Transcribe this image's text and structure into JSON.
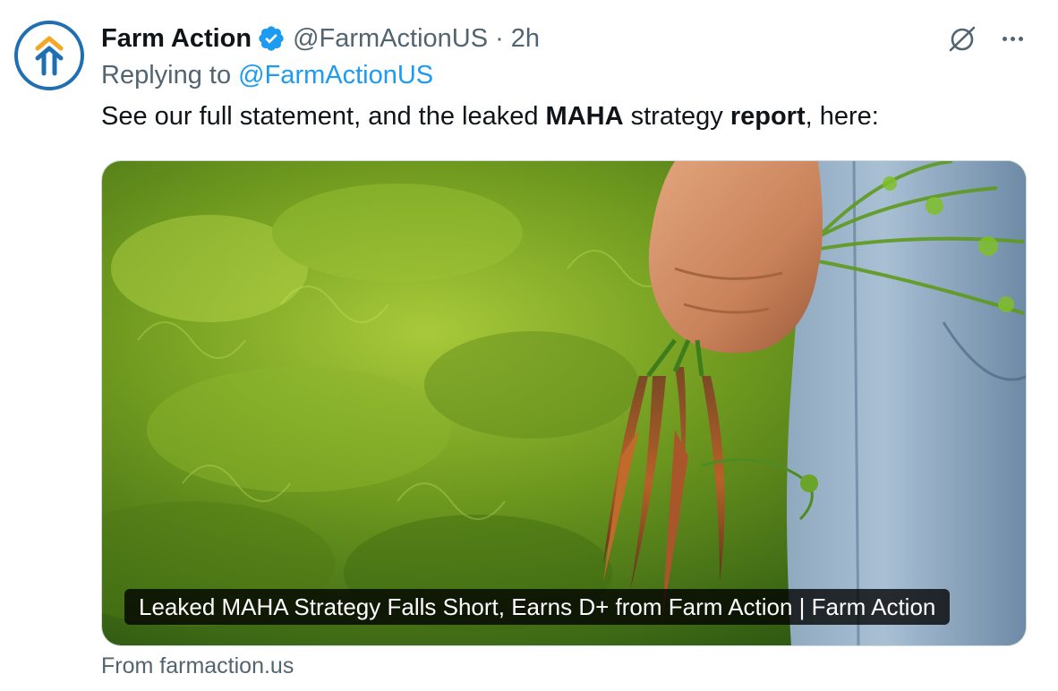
{
  "author": {
    "display_name": "Farm Action",
    "handle": "@FarmActionUS",
    "separator": "·",
    "time": "2h",
    "verified": true,
    "verified_color": "#1d9bf0",
    "avatar_icon": "farm-action-arrow-logo",
    "avatar_colors": [
      "#f5a623",
      "#1f6fb2"
    ]
  },
  "reply": {
    "prefix": "Replying to",
    "target": "@FarmActionUS",
    "link_color": "#1d9bf0"
  },
  "tweet": {
    "text_part1": "See our full statement, and the leaked ",
    "text_bold1": "MAHA",
    "text_part2": " strategy ",
    "text_bold2": "report",
    "text_part3": ", here:"
  },
  "actions": {
    "grok_icon": "grok-icon",
    "more_icon": "more-options-icon"
  },
  "card": {
    "title": "Leaked MAHA Strategy Falls Short, Earns D+ from Farm Action | Farm Action",
    "source": "From farmaction.us",
    "image_subject": "hand-holding-carrots-image"
  }
}
